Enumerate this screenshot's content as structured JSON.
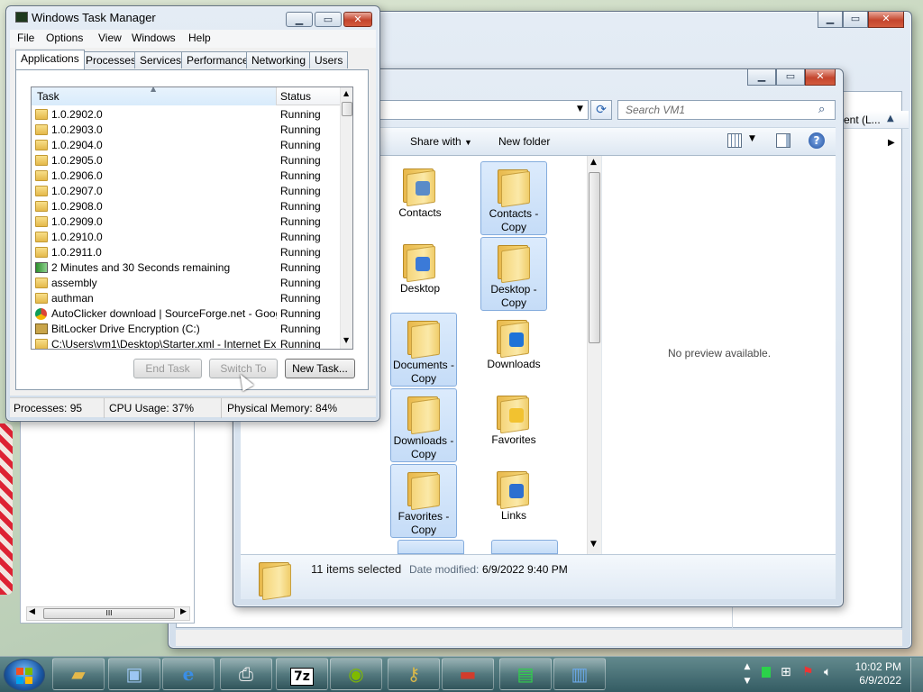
{
  "task_manager": {
    "title": "Windows Task Manager",
    "menu": [
      "File",
      "Options",
      "View",
      "Windows",
      "Help"
    ],
    "tabs": [
      "Applications",
      "Processes",
      "Services",
      "Performance",
      "Networking",
      "Users"
    ],
    "columns": {
      "task": "Task",
      "status": "Status"
    },
    "rows": [
      {
        "icon": "folder-icon",
        "name": "1.0.2902.0",
        "status": "Running"
      },
      {
        "icon": "folder-icon",
        "name": "1.0.2903.0",
        "status": "Running"
      },
      {
        "icon": "folder-icon",
        "name": "1.0.2904.0",
        "status": "Running"
      },
      {
        "icon": "folder-icon",
        "name": "1.0.2905.0",
        "status": "Running"
      },
      {
        "icon": "folder-icon",
        "name": "1.0.2906.0",
        "status": "Running"
      },
      {
        "icon": "folder-icon",
        "name": "1.0.2907.0",
        "status": "Running"
      },
      {
        "icon": "folder-icon",
        "name": "1.0.2908.0",
        "status": "Running"
      },
      {
        "icon": "folder-icon",
        "name": "1.0.2909.0",
        "status": "Running"
      },
      {
        "icon": "folder-icon",
        "name": "1.0.2910.0",
        "status": "Running"
      },
      {
        "icon": "folder-icon",
        "name": "1.0.2911.0",
        "status": "Running"
      },
      {
        "icon": "copy-progress-icon",
        "name": "2 Minutes and 30 Seconds remaining",
        "status": "Running"
      },
      {
        "icon": "folder-icon",
        "name": "assembly",
        "status": "Running"
      },
      {
        "icon": "folder-icon",
        "name": "authman",
        "status": "Running"
      },
      {
        "icon": "chrome-icon",
        "name": "AutoClicker download | SourceForge.net - Googl...",
        "status": "Running"
      },
      {
        "icon": "bitlocker-key-icon",
        "name": "BitLocker Drive Encryption (C:)",
        "status": "Running"
      },
      {
        "icon": "folder-icon",
        "name": "C:\\Users\\vm1\\Desktop\\Starter.xml - Internet Ex...",
        "status": "Running"
      }
    ],
    "buttons": {
      "end_task": "End Task",
      "switch_to": "Switch To",
      "new_task": "New Task..."
    },
    "status_bar": {
      "processes": "Processes: 95",
      "cpu": "CPU Usage: 37%",
      "memory": "Physical Memory: 84%"
    }
  },
  "explorer": {
    "search_placeholder": "Search VM1",
    "toolbar": {
      "share_with": "Share with",
      "new_folder": "New folder"
    },
    "items": [
      {
        "label": "Contacts",
        "selected": false
      },
      {
        "label": "Contacts - Copy",
        "selected": true
      },
      {
        "label": "Desktop",
        "selected": false
      },
      {
        "label": "Desktop - Copy",
        "selected": true
      },
      {
        "label": "Documents - Copy",
        "selected": true
      },
      {
        "label": "Downloads",
        "selected": false
      },
      {
        "label": "Downloads - Copy",
        "selected": true
      },
      {
        "label": "Favorites",
        "selected": false
      },
      {
        "label": "Favorites - Copy",
        "selected": true
      },
      {
        "label": "Links",
        "selected": false
      }
    ],
    "preview_text": "No preview available.",
    "details": {
      "selected": "11 items selected",
      "date_label": "Date modified:",
      "date_value": "6/9/2022 9:40 PM"
    }
  },
  "back_window": {
    "column_partial": "ent (L..."
  },
  "taskbar": {
    "time": "10:02 PM",
    "date": "6/9/2022",
    "apps": [
      "explorer-icon",
      "remote-desktop-icon",
      "internet-explorer-icon",
      "printer-icon",
      "7zip-icon",
      "windows-update-icon",
      "keys-icon",
      "toolbox-icon",
      "task-manager-icon",
      "network-computer-icon"
    ]
  }
}
